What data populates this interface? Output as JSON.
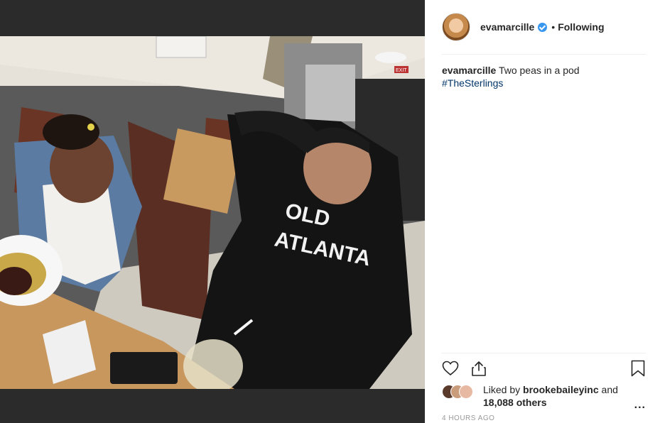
{
  "post": {
    "username": "evamarcille",
    "separator": "•",
    "follow_status": "Following",
    "caption": {
      "username": "evamarcille",
      "text": "Two peas in a pod",
      "hashtag": "#TheSterlings"
    },
    "photo": {
      "sweatshirt_text_line1": "OLD",
      "sweatshirt_text_line2": "ATLANTA",
      "exit_sign": "EXIT"
    },
    "likes": {
      "prefix": "Liked by",
      "liker": "brookebaileyinc",
      "and": "and",
      "others": "18,088 others"
    },
    "more_label": "...",
    "timestamp": "4 HOURS AGO"
  },
  "icons": {
    "verified": "verified-badge-icon",
    "like": "heart-icon",
    "share": "share-icon",
    "save": "bookmark-icon",
    "more": "more-options-icon"
  },
  "colors": {
    "verified_blue": "#3897f0",
    "hashtag": "#003569",
    "timestamp": "#999999",
    "media_background": "#2b2b2b"
  }
}
